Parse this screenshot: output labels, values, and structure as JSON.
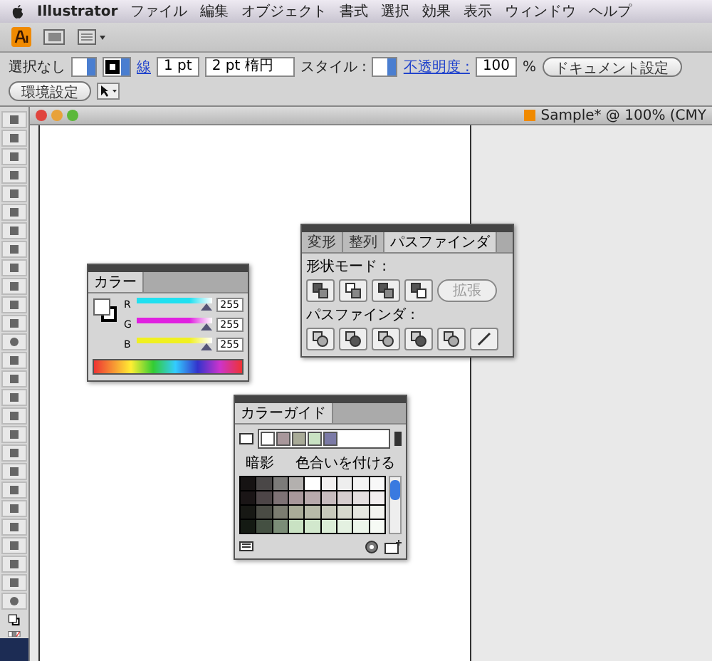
{
  "menu_bar": {
    "app": "Illustrator",
    "items": [
      "ファイル",
      "編集",
      "オブジェクト",
      "書式",
      "選択",
      "効果",
      "表示",
      "ウィンドウ",
      "ヘルプ"
    ]
  },
  "control_bar": {
    "selection": "選択なし",
    "stroke_label": "線",
    "stroke_weight": "1 pt",
    "brush": "2 pt 楕円",
    "style_label": "スタイル :",
    "opacity_label": "不透明度 :",
    "opacity": "100",
    "opacity_unit": "%",
    "buttons": [
      "ドキュメント設定",
      "環境設定"
    ]
  },
  "document": {
    "title": "Sample* @ 100% (CMY"
  },
  "color_panel": {
    "tab": "カラー",
    "channels": [
      {
        "name": "R",
        "color": "#20e0f0",
        "level": 1,
        "value": "255"
      },
      {
        "name": "G",
        "color": "#e020e0",
        "level": 1,
        "value": "255"
      },
      {
        "name": "B",
        "color": "#f0f020",
        "level": 1,
        "value": "255"
      }
    ]
  },
  "pathfinder_panel": {
    "tabs": [
      {
        "label": "変形",
        "selected": false
      },
      {
        "label": "整列",
        "selected": false
      },
      {
        "label": "パスファインダ",
        "selected": true
      }
    ],
    "shape_modes_label": "形状モード :",
    "expand_button": {
      "label": "拡張",
      "disabled": true
    },
    "pathfinders_label": "パスファインダ :"
  },
  "color_guide_panel": {
    "tab": "カラーガイド",
    "harmony": [
      {
        "color": "#ffffff"
      },
      {
        "color": "#a8979b"
      },
      {
        "color": "#a9ab98"
      },
      {
        "color": "#c9e2c3"
      },
      {
        "color": "#7b7aa6"
      }
    ],
    "left_label": "暗影",
    "right_label": "色合いを付ける",
    "swatch_rows": [
      {
        "cells": [
          {
            "color": "#161313"
          },
          {
            "color": "#4a4747"
          },
          {
            "color": "#7c7b79"
          },
          {
            "color": "#b3b0ae"
          },
          {
            "color": "#ffffff"
          },
          {
            "color": "#f2f0f0"
          },
          {
            "color": "#eeeeee"
          },
          {
            "color": "#f4f4f4"
          },
          {
            "color": "#f8f8f8"
          }
        ]
      },
      {
        "cells": [
          {
            "color": "#1a1516"
          },
          {
            "color": "#4d4547"
          },
          {
            "color": "#7e7275"
          },
          {
            "color": "#a8979b"
          },
          {
            "color": "#b8a9ac"
          },
          {
            "color": "#c7bbbe"
          },
          {
            "color": "#d6cdcf"
          },
          {
            "color": "#e5dfe0"
          },
          {
            "color": "#f2eeef"
          }
        ]
      },
      {
        "cells": [
          {
            "color": "#171814"
          },
          {
            "color": "#4a4b44"
          },
          {
            "color": "#7b7c70"
          },
          {
            "color": "#a9ab98"
          },
          {
            "color": "#b8baa9"
          },
          {
            "color": "#c7c9bb"
          },
          {
            "color": "#d6d8cd"
          },
          {
            "color": "#e5e6df"
          },
          {
            "color": "#f2f3ef"
          }
        ]
      },
      {
        "cells": [
          {
            "color": "#141a13"
          },
          {
            "color": "#445042"
          },
          {
            "color": "#7b8d77"
          },
          {
            "color": "#c9e2c3"
          },
          {
            "color": "#d2e8cd"
          },
          {
            "color": "#dbedd7"
          },
          {
            "color": "#e4f1e1"
          },
          {
            "color": "#edf6eb"
          },
          {
            "color": "#f6faf5"
          }
        ]
      }
    ]
  }
}
